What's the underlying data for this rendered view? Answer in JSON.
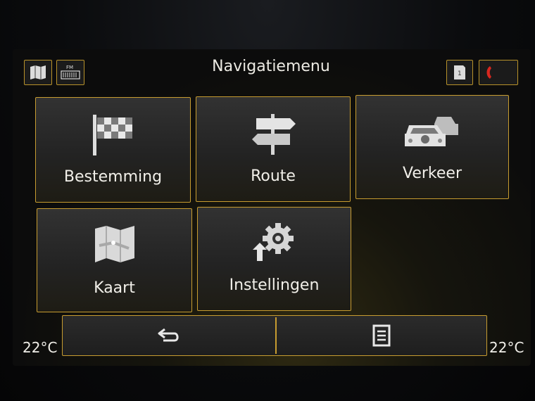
{
  "header": {
    "title": "Navigatiemenu",
    "left_buttons": [
      {
        "icon": "map-book-icon"
      },
      {
        "icon": "radio-fm-icon",
        "badge": "FM"
      }
    ],
    "right_buttons": [
      {
        "icon": "notification-icon",
        "badge": "1"
      },
      {
        "icon": "phone-icon"
      }
    ]
  },
  "menu": {
    "tiles": [
      {
        "label": "Bestemming",
        "icon": "checkered-flag-icon"
      },
      {
        "label": "Route",
        "icon": "signpost-icon"
      },
      {
        "label": "Verkeer",
        "icon": "traffic-cars-icon"
      },
      {
        "label": "Kaart",
        "icon": "map-icon"
      },
      {
        "label": "Instellingen",
        "icon": "settings-gear-icon"
      }
    ]
  },
  "bottom_bar": {
    "back_icon": "back-arrow-icon",
    "list_icon": "list-icon"
  },
  "climate": {
    "left_temp": "22°C",
    "right_temp": "22°C"
  },
  "colors": {
    "accent": "#c79c30",
    "text": "#f1efe9",
    "phone": "#d8271f"
  }
}
